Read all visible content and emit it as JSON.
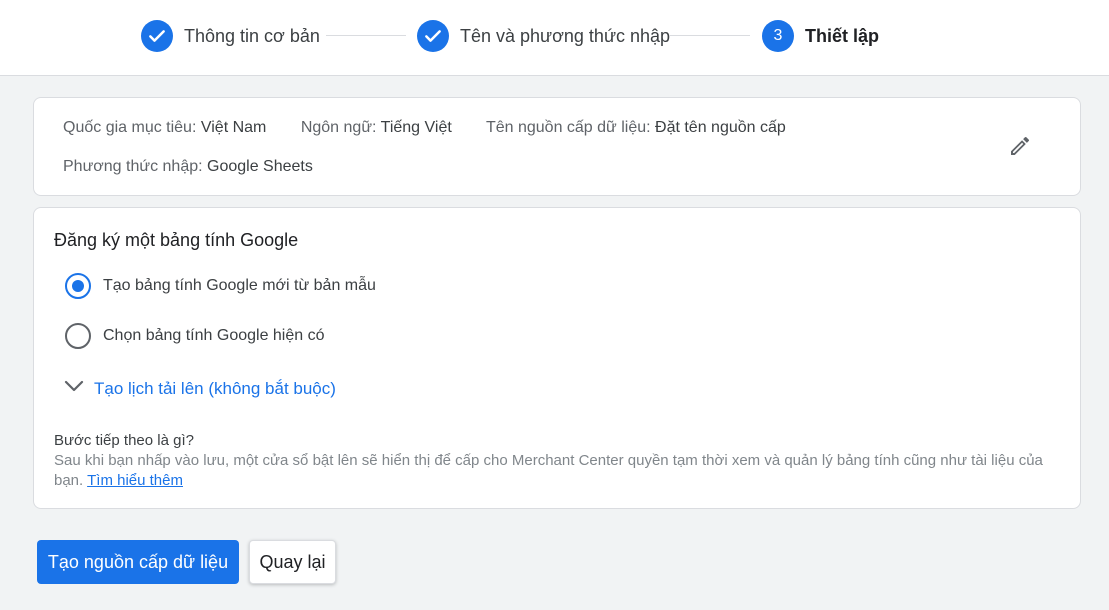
{
  "stepper": {
    "steps": [
      {
        "label": "Thông tin cơ bản",
        "state": "done",
        "icon": "check-icon"
      },
      {
        "label": "Tên và phương thức nhập",
        "state": "done",
        "icon": "check-icon"
      },
      {
        "label": "Thiết lập",
        "state": "active",
        "number": "3"
      }
    ]
  },
  "summary": {
    "country_label": "Quốc gia mục tiêu:",
    "country_value": "Việt Nam",
    "language_label": "Ngôn ngữ:",
    "language_value": "Tiếng Việt",
    "feed_name_label": "Tên nguồn cấp dữ liệu:",
    "feed_name_value": "Đặt tên nguồn cấp",
    "input_method_label": "Phương thức nhập:",
    "input_method_value": "Google Sheets",
    "edit_icon": "pencil-icon"
  },
  "register": {
    "title": "Đăng ký một bảng tính Google",
    "options": [
      {
        "label": "Tạo bảng tính Google mới từ bản mẫu",
        "checked": true
      },
      {
        "label": "Chọn bảng tính Google hiện có",
        "checked": false
      }
    ],
    "schedule_label": "Tạo lịch tải lên (không bắt buộc)",
    "next_title": "Bước tiếp theo là gì?",
    "next_desc": "Sau khi bạn nhấp vào lưu, một cửa sổ bật lên sẽ hiển thị để cấp cho Merchant Center quyền tạm thời xem và quản lý bảng tính cũng như tài liệu của bạn.",
    "learn_more": "Tìm hiểu thêm"
  },
  "actions": {
    "create_label": "Tạo nguồn cấp dữ liệu",
    "back_label": "Quay lại"
  },
  "colors": {
    "accent": "#1a73e8",
    "background": "#f1f3f4"
  }
}
